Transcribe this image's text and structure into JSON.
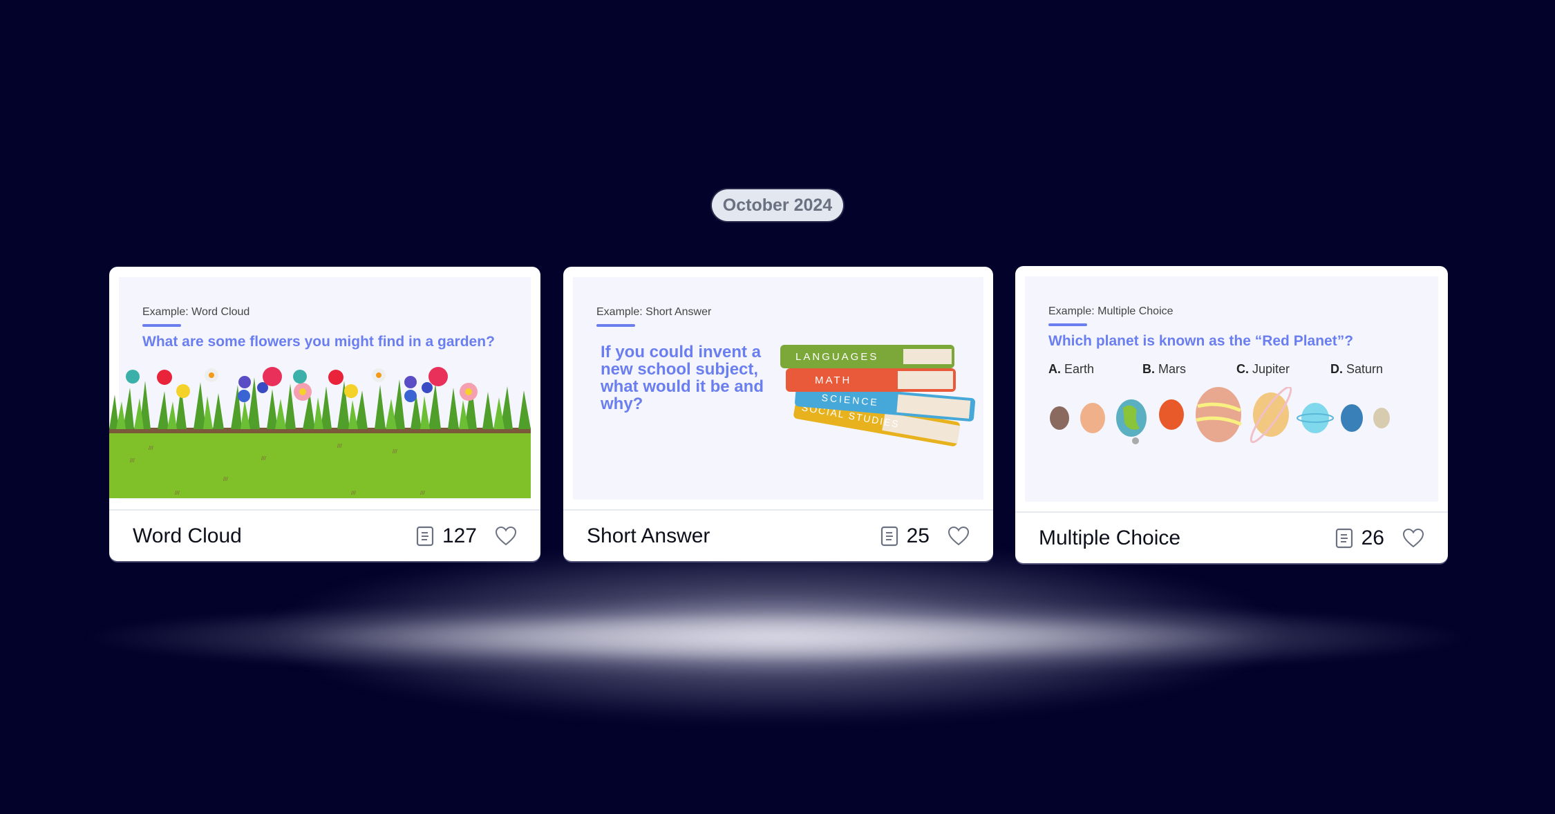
{
  "header": {
    "date_label": "October 2024"
  },
  "colors": {
    "background": "#02022a",
    "accent": "#6a7ef0",
    "pill_bg": "#e2e7f0"
  },
  "cards": [
    {
      "preview_label": "Example: Word Cloud",
      "question": "What are some flowers you might find in a garden?",
      "title": "Word Cloud",
      "count": "127",
      "count_icon": "document-lines-icon",
      "like_icon": "heart-outline-icon",
      "illustration": "flower-garden"
    },
    {
      "preview_label": "Example: Short Answer",
      "question": "If you could invent a new school subject, what would it be and why?",
      "title": "Short Answer",
      "count": "25",
      "count_icon": "document-lines-icon",
      "like_icon": "heart-outline-icon",
      "illustration": "book-stack",
      "book_labels": [
        "LANGUAGES",
        "MATH",
        "SCIENCE",
        "SOCIAL STUDIES"
      ]
    },
    {
      "preview_label": "Example: Multiple Choice",
      "question": "Which planet is known as the “Red Planet”?",
      "title": "Multiple Choice",
      "count": "26",
      "count_icon": "document-lines-icon",
      "like_icon": "heart-outline-icon",
      "illustration": "solar-system-planets",
      "options": [
        {
          "letter": "A.",
          "text": "Earth"
        },
        {
          "letter": "B.",
          "text": "Mars"
        },
        {
          "letter": "C.",
          "text": "Jupiter"
        },
        {
          "letter": "D.",
          "text": "Saturn"
        }
      ]
    }
  ]
}
